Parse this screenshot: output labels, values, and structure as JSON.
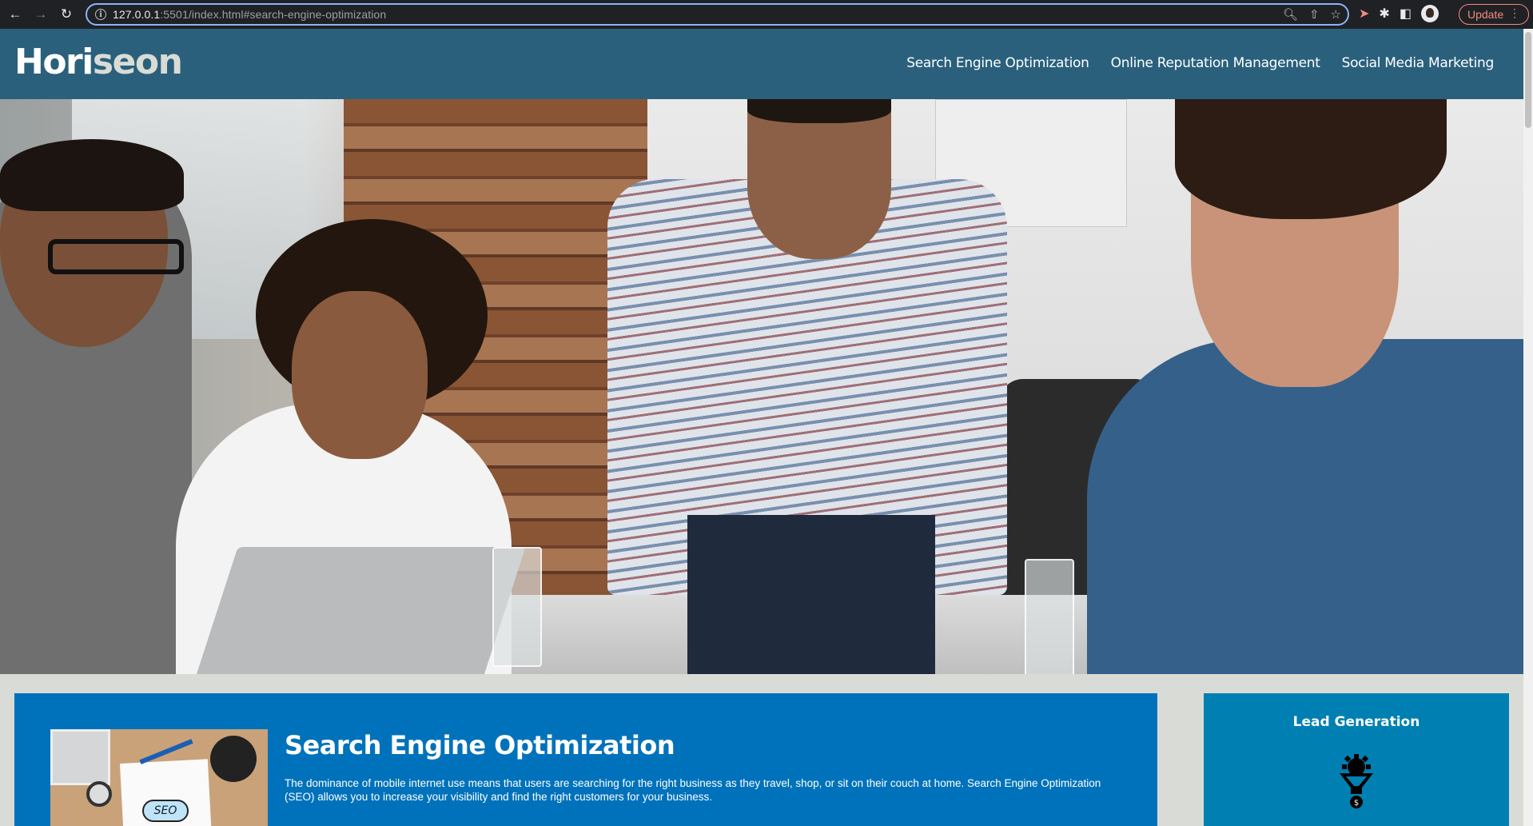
{
  "browser": {
    "url_host": "127.0.0.1",
    "url_rest": ":5501/index.html#search-engine-optimization",
    "update_label": "Update"
  },
  "header": {
    "logo_part1": "Hori",
    "logo_part2": "seon",
    "nav": [
      {
        "label": "Search Engine Optimization"
      },
      {
        "label": "Online Reputation Management"
      },
      {
        "label": "Social Media Marketing"
      }
    ]
  },
  "content": {
    "seo_title": "Search Engine Optimization",
    "seo_text": "The dominance of mobile internet use means that users are searching for the right business as they travel, shop, or sit on their couch at home. Search Engine Optimization (SEO) allows you to increase your visibility and find the right customers for your business.",
    "seo_image_label": "SEO"
  },
  "sidebar": {
    "title": "Lead Generation",
    "icon": "funnel-icon"
  },
  "colors": {
    "header_bg": "#2a607c",
    "page_bg": "#d9dcd6",
    "main_card_bg": "#0072bb",
    "side_card_bg": "#0080b2"
  }
}
